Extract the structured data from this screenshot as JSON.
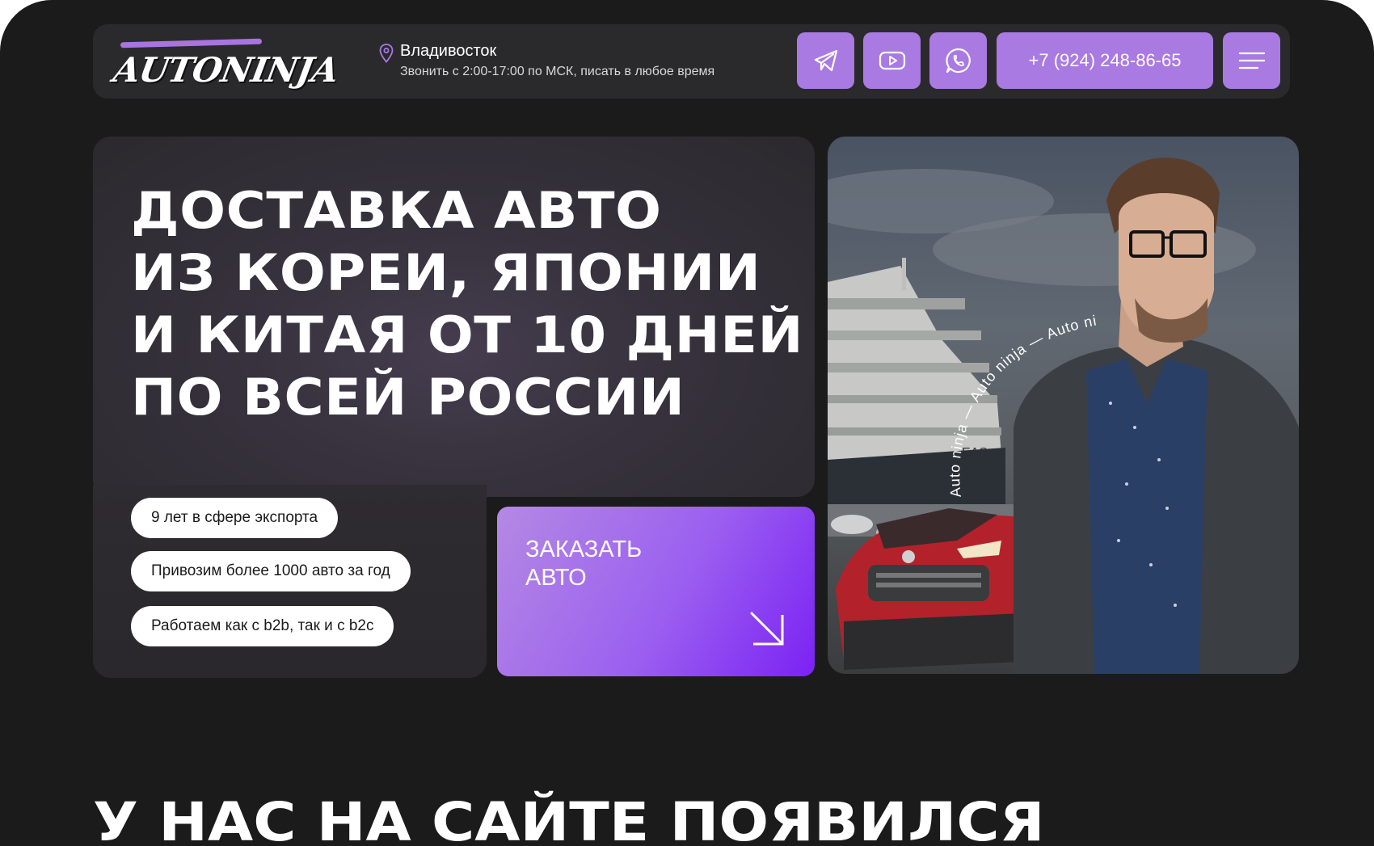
{
  "header": {
    "logo_text": "AUTONINJA",
    "city": "Владивосток",
    "hours": "Звонить с 2:00-17:00 по МСК, писать в любое время",
    "phone": "+7 (924) 248-86-65",
    "icons": [
      "location-pin-icon",
      "telegram-icon",
      "youtube-icon",
      "whatsapp-icon",
      "menu-icon"
    ]
  },
  "hero": {
    "title": "ДОСТАВКА АВТО ИЗ КОРЕИ, ЯПОНИИ И КИТАЯ ОТ 10 ДНЕЙ ПО ВСЕЙ РОССИИ",
    "title_lines": [
      "ДОСТАВКА АВТО",
      "ИЗ КОРЕИ, ЯПОНИИ",
      "И КИТАЯ ОТ 10 ДНЕЙ",
      "ПО ВСЕЙ РОССИИ"
    ],
    "features": [
      "9 лет в сфере экспорта",
      "Привозим более 1000 авто за год",
      "Работаем как с b2b, так и с b2c"
    ],
    "order_button": "ЗАКАЗАТЬ АВТО",
    "order_lines": [
      "ЗАКАЗАТЬ",
      "АВТО"
    ],
    "photo_curve_text": "Auto ninja — Auto ninja — Auto ni"
  },
  "section": {
    "title": "У НАС НА САЙТЕ ПОЯВИЛСЯ"
  },
  "colors": {
    "accent": "#a97ae2",
    "background": "#1b1b1c",
    "header_bg": "#2a2a2c",
    "button_gradient_end": "#7b22f3"
  }
}
